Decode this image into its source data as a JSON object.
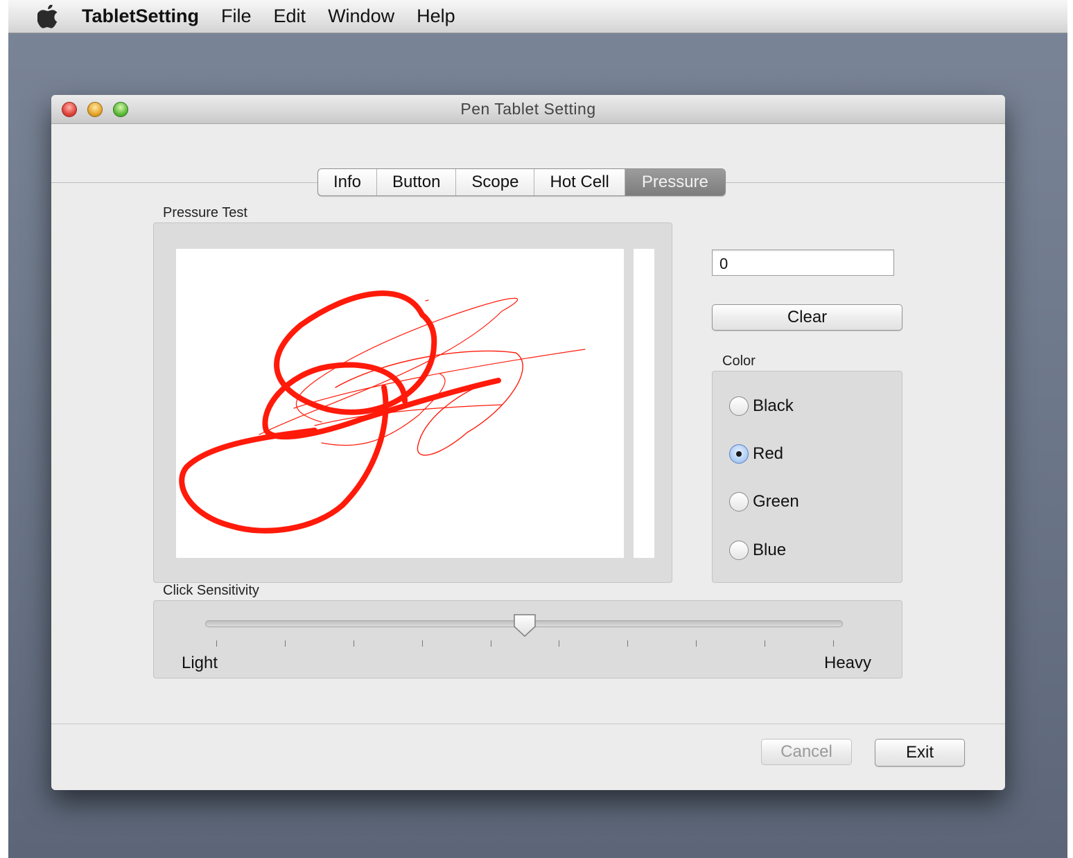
{
  "menubar": {
    "apple_icon": "apple-icon",
    "app_name": "TabletSetting",
    "items": [
      "File",
      "Edit",
      "Window",
      "Help"
    ]
  },
  "window": {
    "title": "Pen Tablet Setting"
  },
  "tabs": [
    {
      "label": "Info",
      "active": false
    },
    {
      "label": "Button",
      "active": false
    },
    {
      "label": "Scope",
      "active": false
    },
    {
      "label": "Hot Cell",
      "active": false
    },
    {
      "label": "Pressure",
      "active": true
    }
  ],
  "pressure_test": {
    "label": "Pressure Test",
    "stroke_color": "#ff1a0a"
  },
  "pressure_value": "0",
  "clear_button": "Clear",
  "color_group": {
    "label": "Color",
    "options": [
      {
        "label": "Black",
        "checked": false
      },
      {
        "label": "Red",
        "checked": true
      },
      {
        "label": "Green",
        "checked": false
      },
      {
        "label": "Blue",
        "checked": false
      }
    ]
  },
  "click_sensitivity": {
    "label": "Click Sensitivity",
    "min_label": "Light",
    "max_label": "Heavy",
    "ticks": 10,
    "value_fraction": 0.5
  },
  "footer": {
    "cancel_label": "Cancel",
    "cancel_enabled": false,
    "exit_label": "Exit"
  }
}
